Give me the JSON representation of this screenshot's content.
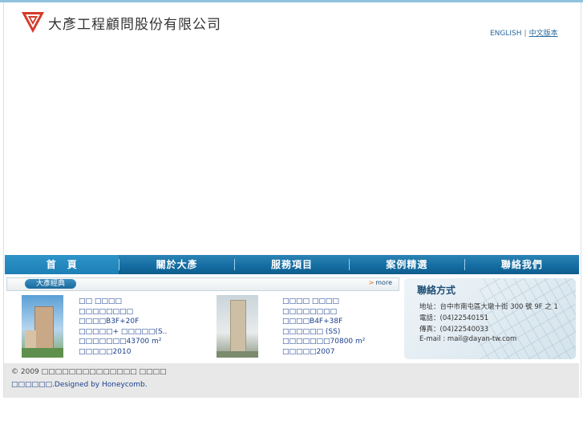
{
  "header": {
    "company_name": "大彥工程顧問股份有限公司",
    "lang_english": "ENGLISH",
    "lang_separator": "|",
    "lang_chinese": "中文版本"
  },
  "nav": {
    "items": [
      {
        "label": "首　頁"
      },
      {
        "label": "關於大彥"
      },
      {
        "label": "服務項目"
      },
      {
        "label": "案例精選"
      },
      {
        "label": "聯絡我們"
      }
    ]
  },
  "classics": {
    "tab_label": "大彥經典",
    "more_arrow": ">",
    "more_label": "more",
    "cases": [
      {
        "name": "□□ □□□□",
        "type": "□□□□□□□□",
        "floors": "□□□□B3F+20F",
        "structure": "□□□□□+ □□□□□(S..",
        "area": "□□□□□□□43700 m²",
        "year": "□□□□□2010"
      },
      {
        "name": "□□□□ □□□□",
        "type": "□□□□□□□□",
        "floors": "□□□□B4F+38F",
        "structure": "□□□□□□ (SS)",
        "area": "□□□□□□□70800 m²",
        "year": "□□□□□2007"
      }
    ]
  },
  "contact": {
    "title": "聯絡方式",
    "address": "地址：台中市南屯區大墩十街 300 號 9F 之 1",
    "phone": "電話：(04)22540151",
    "fax": "傳真：(04)22540033",
    "email": "E-mail : mail@dayan-tw.com"
  },
  "footer": {
    "copyright": "© 2009 □□□□□□□□□□□□□□ □□□□",
    "credit_prefix": "□□□□□□.",
    "credit_text": "Designed by Honeycomb."
  },
  "colors": {
    "brand_red": "#d63a2a",
    "nav_blue": "#156ea3",
    "link_blue": "#1a3f8c"
  }
}
